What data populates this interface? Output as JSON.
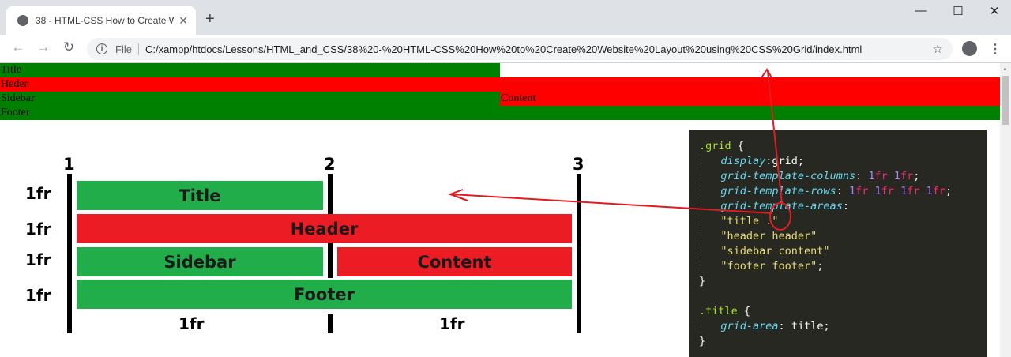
{
  "browser": {
    "tab_title": "38 - HTML-CSS How to Create W",
    "new_tab": "+",
    "scheme_label": "File",
    "url": "C:/xampp/htdocs/Lessons/HTML_and_CSS/38%20-%20HTML-CSS%20How%20to%20Create%20Website%20Layout%20using%20CSS%20Grid/index.html",
    "icons": [
      "back-icon",
      "forward-icon",
      "reload-icon",
      "info-icon",
      "star-icon",
      "profile-icon",
      "menu-icon",
      "minimize-icon",
      "maximize-icon",
      "close-icon"
    ]
  },
  "page": {
    "grid_items": {
      "title": "Title",
      "header": "Heder",
      "sidebar": "Sidebar",
      "content": "Content",
      "footer": "Footer"
    },
    "colors": {
      "green": "#008000",
      "red": "#ff0000"
    }
  },
  "diagram": {
    "line_numbers": [
      "1",
      "2",
      "3"
    ],
    "row_labels": [
      "1fr",
      "1fr",
      "1fr",
      "1fr"
    ],
    "col_labels": [
      "1fr",
      "1fr"
    ],
    "cells": {
      "title": "Title",
      "header": "Header",
      "sidebar": "Sidebar",
      "content": "Content",
      "footer": "Footer"
    },
    "colors": {
      "green": "#22ad4b",
      "red": "#ec1c24"
    }
  },
  "code": {
    "l1_sel": ".grid",
    "l1_rest": " {",
    "l2_prop": "display",
    "l2_val": ":grid;",
    "l3_prop": "grid-template-columns",
    "l3_colon": ": ",
    "l3_n1": "1",
    "l3_u1": "fr",
    "l3_n2": "1",
    "l3_u2": "fr",
    "l3_end": ";",
    "l4_prop": "grid-template-rows",
    "l4_colon": ": ",
    "l4_n1": "1",
    "l4_u1": "fr",
    "l4_n2": "1",
    "l4_u2": "fr",
    "l4_n3": "1",
    "l4_u3": "fr",
    "l4_n4": "1",
    "l4_u4": "fr",
    "l4_end": ";",
    "l5_prop": "grid-template-areas",
    "l5_colon": ":",
    "l6_str": "\"title .\"",
    "l7_str": "\"header header\"",
    "l8_str": "\"sidebar content\"",
    "l9_str": "\"footer footer\"",
    "l9_end": ";",
    "l10": "}",
    "l12_sel": ".title",
    "l12_rest": " {",
    "l13_prop": "grid-area",
    "l13_colon": ": ",
    "l13_val": "title;",
    "l14": "}"
  }
}
